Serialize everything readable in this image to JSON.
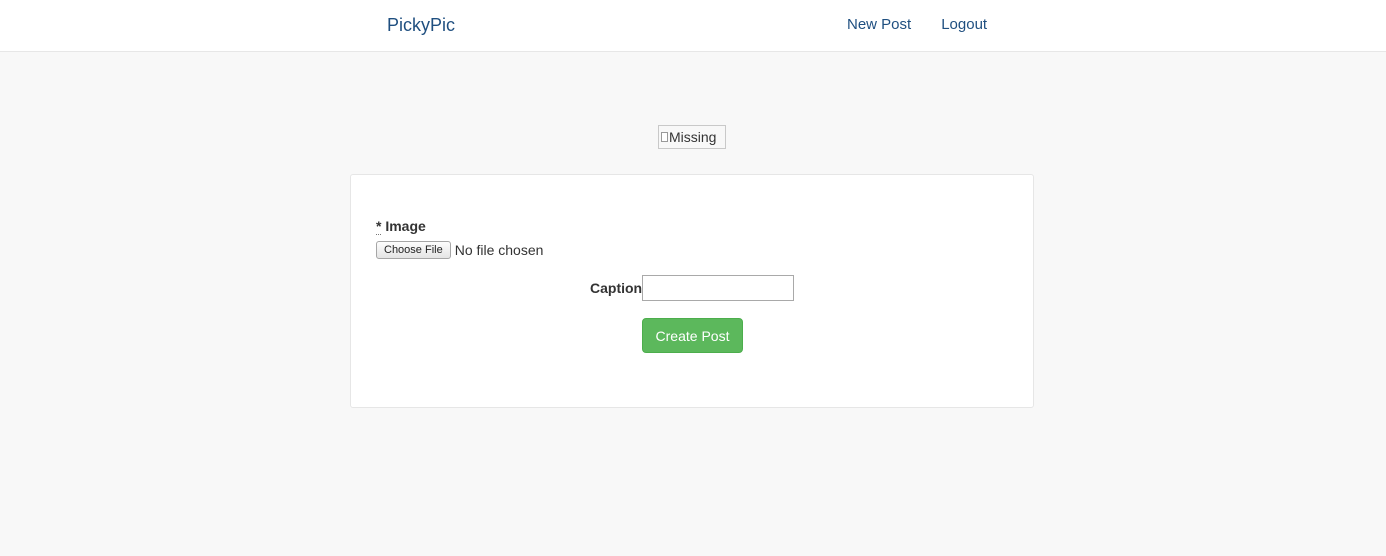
{
  "navbar": {
    "brand": "PickyPic",
    "links": [
      {
        "label": "New Post"
      },
      {
        "label": "Logout"
      }
    ],
    "link_color": "#1f4f80"
  },
  "preview_image": {
    "alt_text": "Missing"
  },
  "form": {
    "image_field": {
      "required_mark": "*",
      "label": "Image",
      "button_label": "Choose File",
      "status": "No file chosen"
    },
    "caption_field": {
      "label": "Caption",
      "value": ""
    },
    "submit_label": "Create Post",
    "submit_color": "#5cb85c"
  }
}
